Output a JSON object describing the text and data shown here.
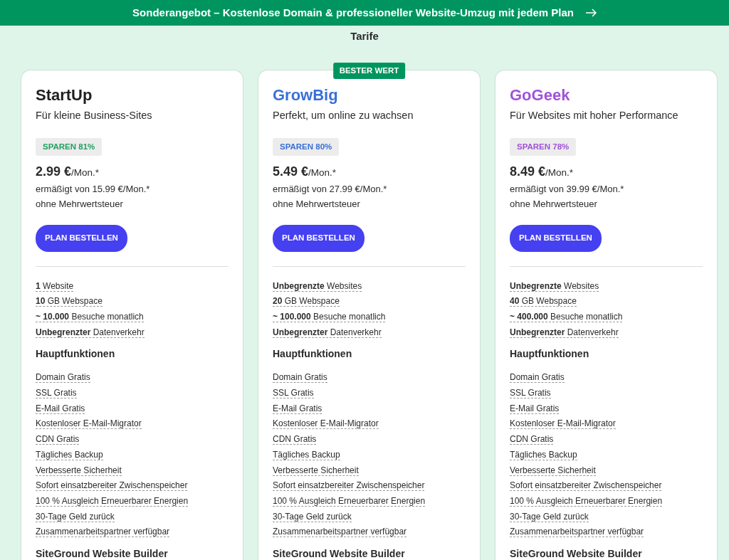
{
  "banner": {
    "text": "Sonderangebot – Kostenlose Domain & professioneller Website-Umzug mit jedem Plan"
  },
  "section_title": "Tarife",
  "plans": [
    {
      "name": "StartUp",
      "name_colored": false,
      "color": "#21a063",
      "subtitle": "Für kleine Business-Sites",
      "savings": "SPAREN 81%",
      "price": "**2.99 €**/Mon.*",
      "regular": "ermäßigt von 15.99 €/Mon.*",
      "tax_note": "ohne Mehrwertsteuer",
      "button": "PLAN BESTELLEN",
      "resources": [
        "**1** Website",
        "**10** GB Webspace",
        "**~ 10.000** Besuche monatlich",
        "**Unbegrenzter** Datenverkehr"
      ],
      "features_heading": "Hauptfunktionen",
      "features": [
        "Domain Gratis",
        "SSL Gratis",
        "E-Mail Gratis",
        "Kostenloser E-Mail-Migrator",
        "CDN Gratis",
        "Tägliches Backup",
        "Verbesserte Sicherheit",
        "Sofort einsatzbereiter Zwischenspeicher",
        "100 % Ausgleich Erneuerbarer Energien",
        "30-Tage Geld zurück",
        "Zusammenarbeitspartner verfügbar"
      ],
      "builder_heading": "SiteGround Website Builder"
    },
    {
      "name": "GrowBig",
      "name_colored": true,
      "color": "#3a6fd8",
      "badge": "BESTER WERT",
      "subtitle": "Perfekt, um online zu wachsen",
      "savings": "SPAREN 80%",
      "price": "**5.49 €**/Mon.*",
      "regular": "ermäßigt von 27.99 €/Mon.*",
      "tax_note": "ohne Mehrwertsteuer",
      "button": "PLAN BESTELLEN",
      "resources": [
        "**Unbegrenzte** Websites",
        "**20** GB Webspace",
        "**~ 100.000** Besuche monatlich",
        "**Unbegrenzter** Datenverkehr"
      ],
      "features_heading": "Hauptfunktionen",
      "features": [
        "Domain Gratis",
        "SSL Gratis",
        "E-Mail Gratis",
        "Kostenloser E-Mail-Migrator",
        "CDN Gratis",
        "Tägliches Backup",
        "Verbesserte Sicherheit",
        "Sofort einsatzbereiter Zwischenspeicher",
        "100 % Ausgleich Erneuerbarer Energien",
        "30-Tage Geld zurück",
        "Zusammenarbeitspartner verfügbar"
      ],
      "builder_heading": "SiteGround Website Builder"
    },
    {
      "name": "GoGeek",
      "name_colored": true,
      "color": "#a151d8",
      "subtitle": "Für Websites mit hoher Performance",
      "savings": "SPAREN 78%",
      "price": "**8.49 €**/Mon.*",
      "regular": "ermäßigt von 39.99 €/Mon.*",
      "tax_note": "ohne Mehrwertsteuer",
      "button": "PLAN BESTELLEN",
      "resources": [
        "**Unbegrenzte** Websites",
        "**40** GB Webspace",
        "**~ 400.000** Besuche monatlich",
        "**Unbegrenzter** Datenverkehr"
      ],
      "features_heading": "Hauptfunktionen",
      "features": [
        "Domain Gratis",
        "SSL Gratis",
        "E-Mail Gratis",
        "Kostenloser E-Mail-Migrator",
        "CDN Gratis",
        "Tägliches Backup",
        "Verbesserte Sicherheit",
        "Sofort einsatzbereiter Zwischenspeicher",
        "100 % Ausgleich Erneuerbarer Energien",
        "30-Tage Geld zurück",
        "Zusammenarbeitspartner verfügbar"
      ],
      "builder_heading": "SiteGround Website Builder"
    }
  ]
}
